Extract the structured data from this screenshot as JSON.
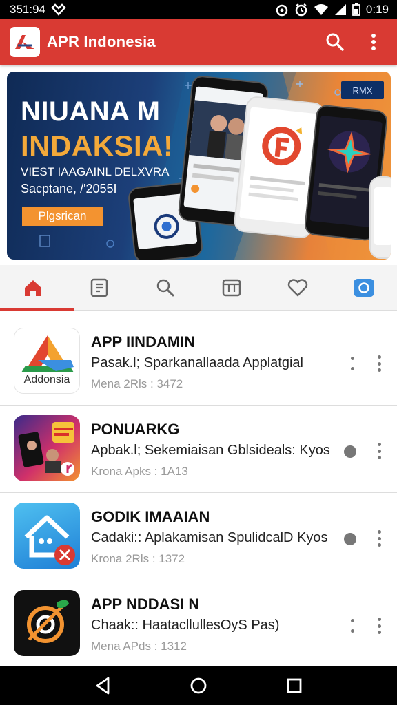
{
  "status_bar": {
    "time_left": "351:94",
    "time_right": "0:19"
  },
  "app_bar": {
    "title": "APR Indonesia",
    "search_icon": "search-icon",
    "menu_icon": "more-vert-icon"
  },
  "banner": {
    "headline_1": "NIUANA M",
    "headline_2": "INDAKSIA!",
    "subtitle_1": "VIEST IAAGAINL DELXVRA",
    "subtitle_2": "Sacptane, /'2055I",
    "cta_label": "Plgsrican",
    "badge": "RMX"
  },
  "tabs": [
    {
      "icon": "home-icon",
      "active": true
    },
    {
      "icon": "document-icon"
    },
    {
      "icon": "search-icon"
    },
    {
      "icon": "grid-icon"
    },
    {
      "icon": "heart-icon"
    },
    {
      "icon": "camera-icon"
    }
  ],
  "apps": [
    {
      "name": "APP IINDAMIN",
      "description": "Pasak.l; Sparkanallaada Applatgial",
      "meta": "Mena 2Rls : 3472",
      "icon_caption": "Addonsia"
    },
    {
      "name": "PONUARKG",
      "description": "Apbak.l; Sekemiaisan Gblsideals: Kyos",
      "meta": "Krona Apks : 1A13"
    },
    {
      "name": "GODIK IMAAIAN",
      "description": "Cadaki:: Aplakamisan SpulidcalD Kyos",
      "meta": "Krona 2Rls : 1372"
    },
    {
      "name": "APP NDDASI N",
      "description": "Chaak:: HaatacllullesOyS Pas)",
      "meta": "Mena APds : 1312"
    }
  ],
  "colors": {
    "primary": "#d93a33",
    "accent": "#f39330",
    "banner_dark": "#0f2a55"
  }
}
